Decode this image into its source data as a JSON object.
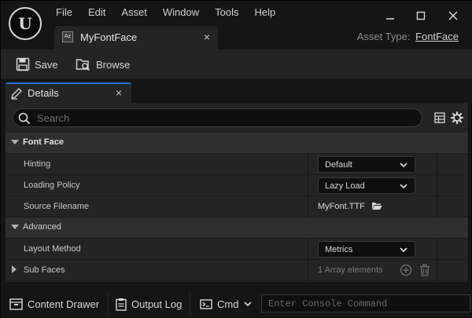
{
  "app": {
    "logo_text": "U",
    "menu": [
      "File",
      "Edit",
      "Asset",
      "Window",
      "Tools",
      "Help"
    ],
    "window_controls": [
      "minimize-icon",
      "maximize-icon",
      "close-icon"
    ]
  },
  "doc_tab": {
    "icon_text": "Az",
    "label": "MyFontFace",
    "close": "×"
  },
  "asset_type": {
    "prefix": "Asset Type:",
    "link": "FontFace"
  },
  "toolbar": {
    "save_label": "Save",
    "browse_label": "Browse"
  },
  "details": {
    "tab_label": "Details",
    "tab_close": "×",
    "search_placeholder": "Search",
    "categories": {
      "font_face": "Font Face",
      "advanced": "Advanced"
    },
    "properties": {
      "hinting": {
        "label": "Hinting",
        "value": "Default"
      },
      "loading_policy": {
        "label": "Loading Policy",
        "value": "Lazy Load"
      },
      "source_filename": {
        "label": "Source Filename",
        "value": "MyFont.TTF"
      },
      "layout_method": {
        "label": "Layout Method",
        "value": "Metrics"
      },
      "sub_faces": {
        "label": "Sub Faces",
        "value": "1 Array elements"
      }
    }
  },
  "statusbar": {
    "content_drawer": "Content Drawer",
    "output_log": "Output Log",
    "cmd": "Cmd",
    "console_placeholder": "Enter Console Command"
  },
  "colors": {
    "accent": "#2b6fd6",
    "background": "#151515",
    "panel": "#242424"
  }
}
